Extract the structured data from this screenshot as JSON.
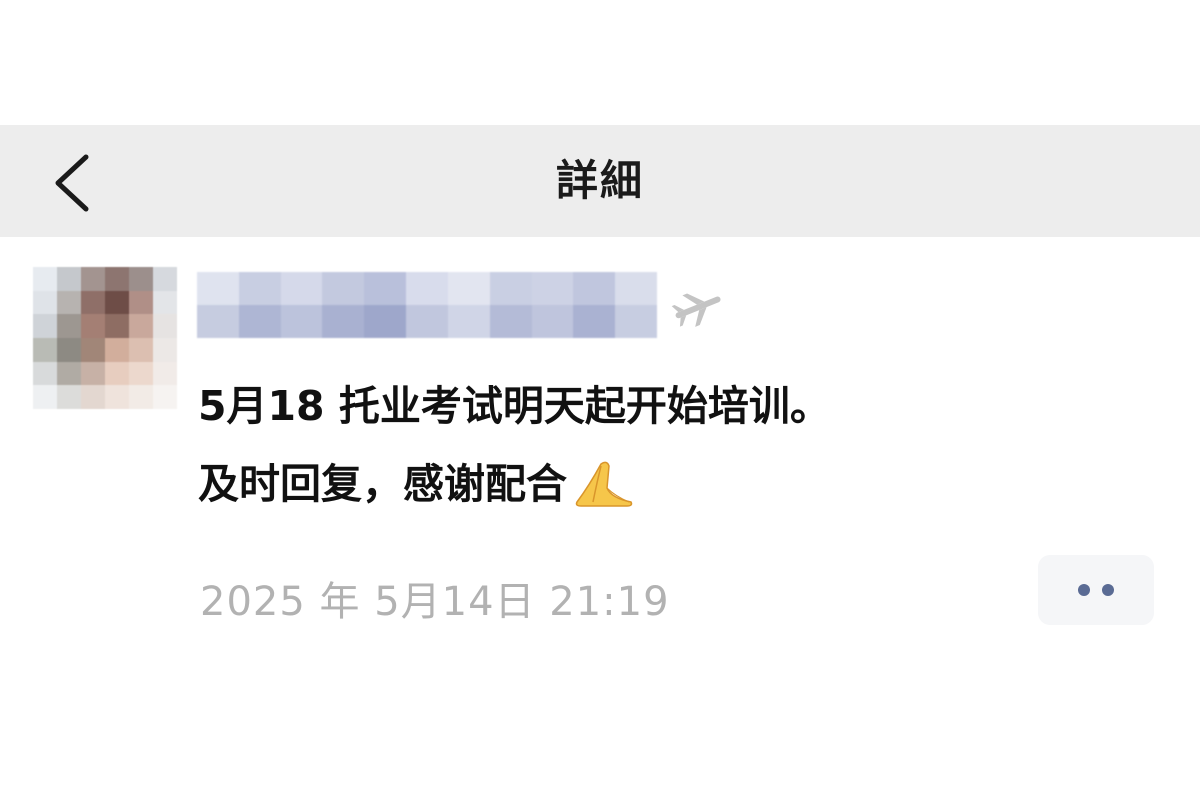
{
  "nav": {
    "title": "詳細",
    "back_icon": "chevron-left-icon"
  },
  "post": {
    "username_state": "pixelated",
    "badge_icon": "airplane-icon",
    "content_lines": [
      "5月18 托业考试明天起开始培训。",
      "及时回复，感谢配合"
    ],
    "emoji": "folded-hands-emoji",
    "timestamp": "2025 年 5月14日 21:19",
    "more_icon": "two-dots-icon"
  },
  "colors": {
    "nav_background": "#ededed",
    "page_background": "#ffffff",
    "timestamp_gray": "#b2b2b2",
    "more_dots": "#5a6b94",
    "text_dark": "#111111"
  }
}
